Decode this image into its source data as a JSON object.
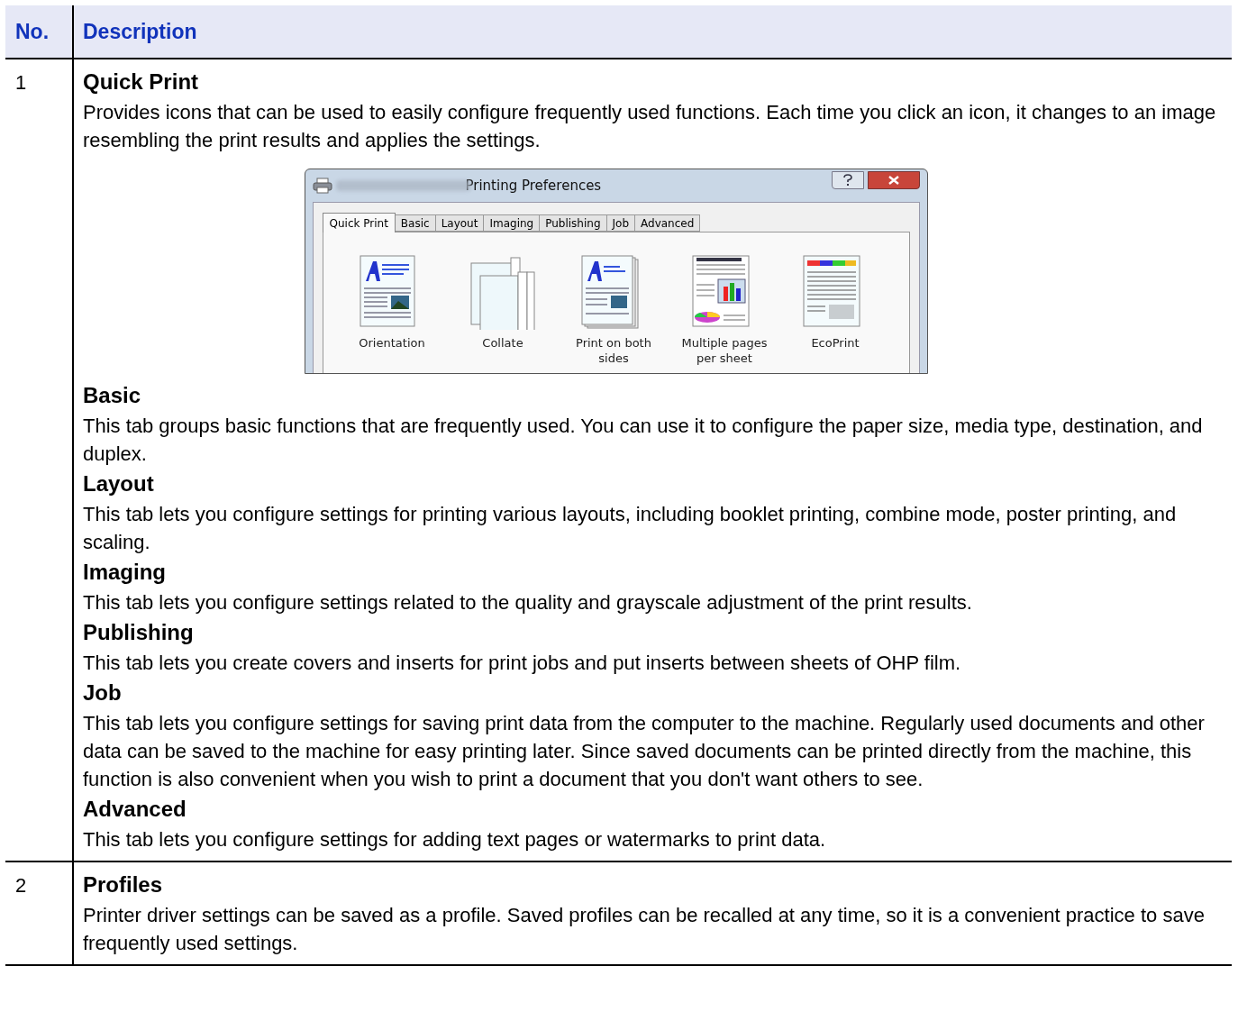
{
  "table": {
    "columns": [
      "No.",
      "Description"
    ],
    "rows": [
      {
        "no": "1",
        "sections": [
          {
            "heading": "Quick Print",
            "text": "Provides icons that can be used to easily configure frequently used functions. Each time you click an icon, it changes to an image resembling the print results and applies the settings.",
            "dialog": {
              "title": "Printing Preferences",
              "tabs": [
                {
                  "label": "Quick Print",
                  "selected": true
                },
                {
                  "label": "Basic",
                  "selected": false
                },
                {
                  "label": "Layout",
                  "selected": false
                },
                {
                  "label": "Imaging",
                  "selected": false
                },
                {
                  "label": "Publishing",
                  "selected": false
                },
                {
                  "label": "Job",
                  "selected": false
                },
                {
                  "label": "Advanced",
                  "selected": false
                }
              ],
              "options": [
                {
                  "kind": "orientation",
                  "label": "Orientation"
                },
                {
                  "kind": "collate",
                  "label": "Collate"
                },
                {
                  "kind": "duplex",
                  "label": "Print on both sides"
                },
                {
                  "kind": "multiple",
                  "label": "Multiple pages per sheet"
                },
                {
                  "kind": "eco",
                  "label": "EcoPrint"
                }
              ]
            }
          },
          {
            "heading": "Basic",
            "text": "This tab groups basic functions that are frequently used. You can use it to configure the paper size, media type, destination, and duplex."
          },
          {
            "heading": "Layout",
            "text": "This tab lets you configure settings for printing various layouts, including booklet printing, combine mode, poster printing, and scaling."
          },
          {
            "heading": "Imaging",
            "text": "This tab lets you configure settings related to the quality and grayscale adjustment of the print results."
          },
          {
            "heading": "Publishing",
            "text": "This tab lets you create covers and inserts for print jobs and put inserts between sheets of OHP film."
          },
          {
            "heading": "Job",
            "text": "This tab lets you configure settings for saving print data from the computer to the machine. Regularly used documents and other data can be saved to the machine for easy printing later. Since saved documents can be printed directly from the machine, this function is also convenient when you wish to print a document that you don't want others to see."
          },
          {
            "heading": "Advanced",
            "text": "This tab lets you configure settings for adding text pages or watermarks to print data."
          }
        ]
      },
      {
        "no": "2",
        "sections": [
          {
            "heading": "Profiles",
            "text": "Printer driver settings can be saved as a profile. Saved profiles can be recalled at any time, so it is a convenient practice to save frequently used settings."
          }
        ]
      }
    ]
  }
}
